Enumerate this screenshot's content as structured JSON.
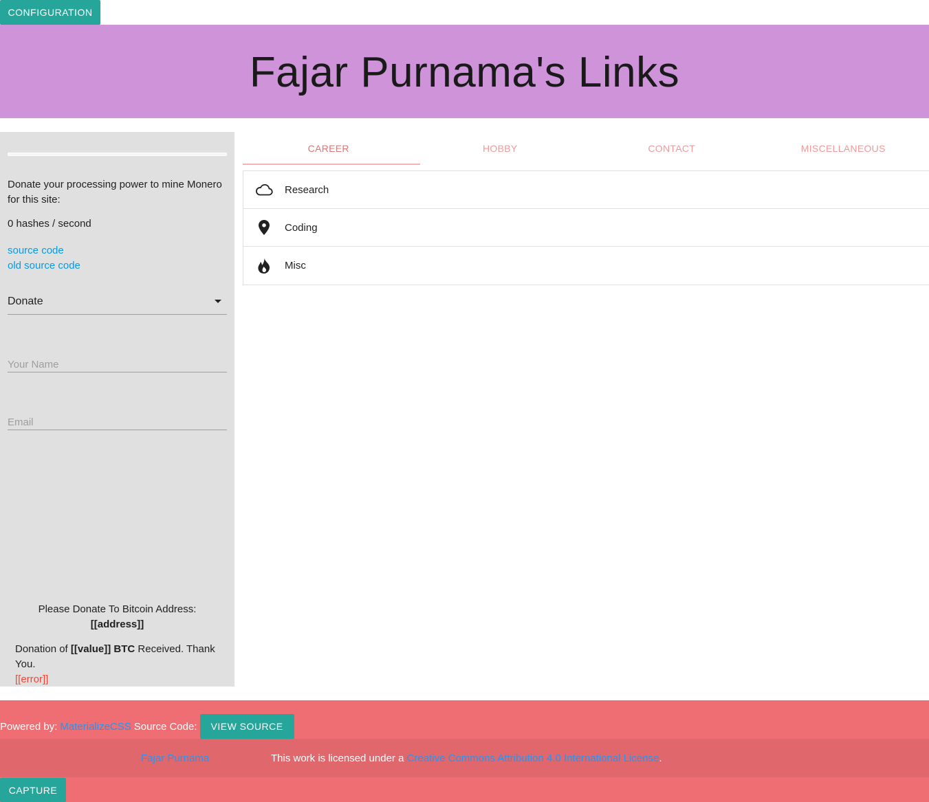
{
  "header": {
    "config_label": "CONFIGURATION",
    "title": "Fajar Purnama's Links",
    "accent_color": "#ce93d8"
  },
  "sidebar": {
    "mining_progress": 0,
    "donate_text": "Donate your processing power to mine Monero for this site:",
    "hashes_text": "0 hashes / second",
    "source_code_link": "source code",
    "old_source_code_link": "old source code",
    "select_value": "Donate",
    "name_placeholder": "Your Name",
    "email_placeholder": "Email",
    "btc_prompt": "Please Donate To Bitcoin Address:",
    "btc_address": "[[address]]",
    "thanks_prefix": "Donation of",
    "thanks_value": "[[value]] BTC",
    "thanks_suffix": "Received. Thank You.",
    "error_text": "[[error]]"
  },
  "tabs": [
    {
      "label": "CAREER",
      "active": true
    },
    {
      "label": "HOBBY",
      "active": false
    },
    {
      "label": "CONTACT",
      "active": false
    },
    {
      "label": "MISCELLANEOUS",
      "active": false
    }
  ],
  "list_items": [
    {
      "label": "Research",
      "icon": "cloud-icon"
    },
    {
      "label": "Coding",
      "icon": "location-pin-icon"
    },
    {
      "label": "Misc",
      "icon": "whatshot-icon"
    }
  ],
  "footer": {
    "powered_by": "Powered by:",
    "materialize_link": "MaterializeCSS",
    "source_code_label": "Source Code:",
    "view_source_label": "VIEW SOURCE",
    "author_link": "Fajar Purnama",
    "license_prefix": "This work is licensed under a",
    "license_link": "Creative Commons Attribution 4.0 International License",
    "license_suffix": ".",
    "capture_label": "CAPTURE",
    "footer_color": "#ee6e73"
  }
}
